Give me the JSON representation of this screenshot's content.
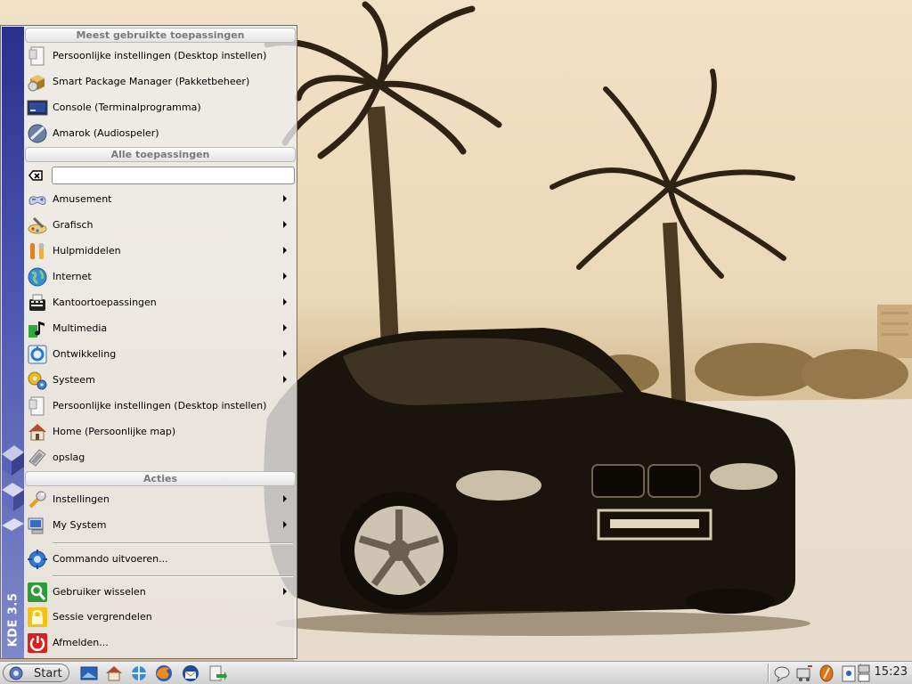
{
  "start_menu": {
    "brand_label": "KDE 3.5",
    "sections": {
      "most_used": "Meest gebruikte toepassingen",
      "all_apps": "Alle toepassingen",
      "actions": "Acties"
    },
    "most_used_items": [
      {
        "label": "Persoonlijke instellingen (Desktop instellen)",
        "icon": "settings-document-icon"
      },
      {
        "label": "Smart Package Manager (Pakketbeheer)",
        "icon": "package-manager-icon"
      },
      {
        "label": "Console (Terminalprogramma)",
        "icon": "terminal-icon"
      },
      {
        "label": "Amarok (Audiospeler)",
        "icon": "amarok-icon"
      }
    ],
    "search": {
      "value": "",
      "placeholder": ""
    },
    "all_apps_items": [
      {
        "label": "Amusement",
        "icon": "gamepad-icon",
        "submenu": true
      },
      {
        "label": "Grafisch",
        "icon": "graphics-icon",
        "submenu": true
      },
      {
        "label": "Hulpmiddelen",
        "icon": "tools-icon",
        "submenu": true
      },
      {
        "label": "Internet",
        "icon": "globe-icon",
        "submenu": true
      },
      {
        "label": "Kantoortoepassingen",
        "icon": "office-icon",
        "submenu": true
      },
      {
        "label": "Multimedia",
        "icon": "multimedia-icon",
        "submenu": true
      },
      {
        "label": "Ontwikkeling",
        "icon": "development-icon",
        "submenu": true
      },
      {
        "label": "Systeem",
        "icon": "system-gears-icon",
        "submenu": true
      },
      {
        "label": "Persoonlijke instellingen (Desktop instellen)",
        "icon": "settings-document-icon",
        "submenu": false
      },
      {
        "label": "Home (Persoonlijke map)",
        "icon": "home-icon",
        "submenu": false
      },
      {
        "label": "opslag",
        "icon": "storage-icon",
        "submenu": false
      }
    ],
    "actions_items": [
      {
        "label": "Instellingen",
        "icon": "wrench-icon",
        "submenu": true
      },
      {
        "label": "My System",
        "icon": "computer-icon",
        "submenu": true
      },
      {
        "label": "Commando uitvoeren...",
        "icon": "run-command-icon",
        "submenu": false
      },
      {
        "label": "Gebruiker wisselen",
        "icon": "switch-user-icon",
        "submenu": true
      },
      {
        "label": "Sessie vergrendelen",
        "icon": "lock-icon",
        "submenu": false
      },
      {
        "label": "Afmelden...",
        "icon": "logout-icon",
        "submenu": false
      }
    ]
  },
  "taskbar": {
    "start_label": "Start",
    "clock": "15:23"
  },
  "colors": {
    "menu_strip": "#2b2f8c",
    "taskbar": "#dcdcdc",
    "wallpaper_tone": "#e8d4b2"
  }
}
